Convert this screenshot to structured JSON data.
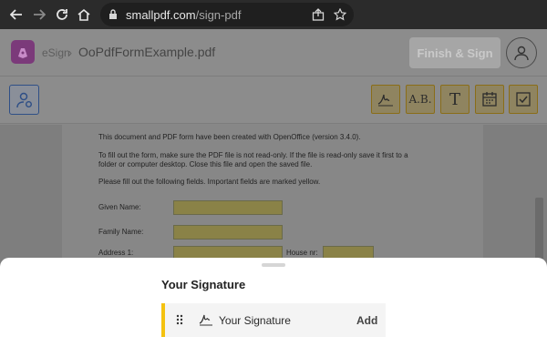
{
  "browser": {
    "url_domain": "smallpdf.com",
    "url_path": "/sign-pdf"
  },
  "header": {
    "app_name": "eSign",
    "separator": "›",
    "document_title": "OoPdfFormExample.pdf",
    "finish_button": "Finish & Sign"
  },
  "toolbar": {
    "tools": [
      {
        "name": "signature-tool",
        "icon": "signature-icon"
      },
      {
        "name": "initials-tool",
        "icon": "initials-icon",
        "label": "A.B."
      },
      {
        "name": "text-tool",
        "icon": "text-icon",
        "label": "T"
      },
      {
        "name": "date-tool",
        "icon": "calendar-icon"
      },
      {
        "name": "checkbox-tool",
        "icon": "checkbox-icon"
      }
    ]
  },
  "document": {
    "lines": [
      "This document and PDF form have been created with OpenOffice (version 3.4.0).",
      "To fill out the form, make sure the PDF file is not read-only. If the file is read-only save it first to a",
      "folder or computer desktop. Close this file and open the saved file.",
      "Please fill out the following fields. Important fields are marked yellow."
    ],
    "field_labels": {
      "given_name": "Given Name:",
      "family_name": "Family Name:",
      "address": "Address 1:",
      "house_nr": "House nr:"
    }
  },
  "sheet": {
    "title": "Your Signature",
    "item_label": "Your Signature",
    "add_label": "Add"
  },
  "colors": {
    "accent_yellow": "#f4c210",
    "signer_blue": "#2f4f86",
    "logo_purple": "#7b3a7a"
  }
}
